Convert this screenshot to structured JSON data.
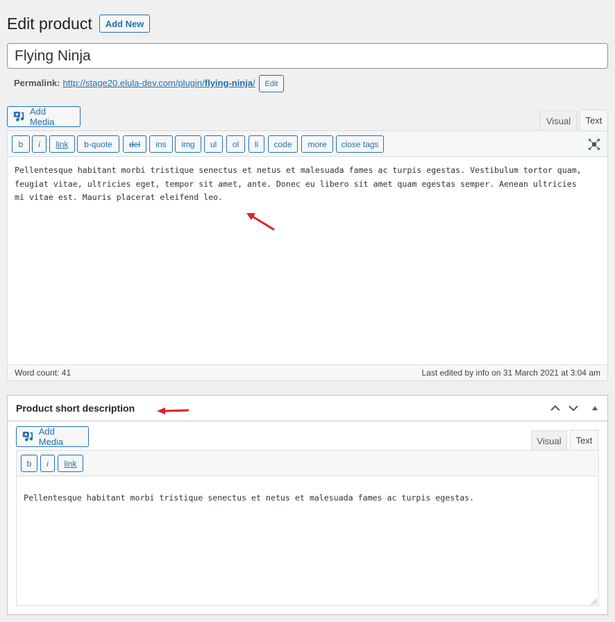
{
  "header": {
    "title": "Edit product",
    "add_new_label": "Add New"
  },
  "post_title": {
    "value": "Flying Ninja"
  },
  "permalink": {
    "label": "Permalink:",
    "url_base": "http://stage20.elula-dev.com/plugin/",
    "slug": "flying-ninja",
    "url_suffix": "/",
    "edit_label": "Edit"
  },
  "main_editor": {
    "add_media_label": "Add Media",
    "tabs": [
      {
        "label": "Visual",
        "active": false
      },
      {
        "label": "Text",
        "active": true
      }
    ],
    "quicktags": [
      "b",
      "i",
      "link",
      "b-quote",
      "del",
      "ins",
      "img",
      "ul",
      "ol",
      "li",
      "code",
      "more",
      "close tags"
    ],
    "fullscreen_icon": "fullscreen-icon",
    "content": "Pellentesque habitant morbi tristique senectus et netus et malesuada fames ac turpis egestas. Vestibulum tortor quam,\nfeugiat vitae, ultricies eget, tempor sit amet, ante. Donec eu libero sit amet quam egestas semper. Aenean ultricies\nmi vitae est. Mauris placerat eleifend leo.",
    "word_count": "Word count: 41",
    "last_edited": "Last edited by info on 31 March 2021 at 3:04 am"
  },
  "short_description": {
    "title": "Product short description",
    "handle_icons": [
      "chevron-up-icon",
      "chevron-down-icon",
      "toggle-arrow-icon"
    ],
    "add_media_label": "Add Media",
    "tabs": [
      {
        "label": "Visual",
        "active": false
      },
      {
        "label": "Text",
        "active": true
      }
    ],
    "quicktags": [
      "b",
      "i",
      "link"
    ],
    "content": "Pellentesque habitant morbi tristique senectus et netus et malesuada fames ac turpis egestas."
  },
  "annotations": {
    "arrow_color": "#e02020"
  },
  "colors": {
    "accent": "#2271b1",
    "background": "#f0f0f1"
  }
}
